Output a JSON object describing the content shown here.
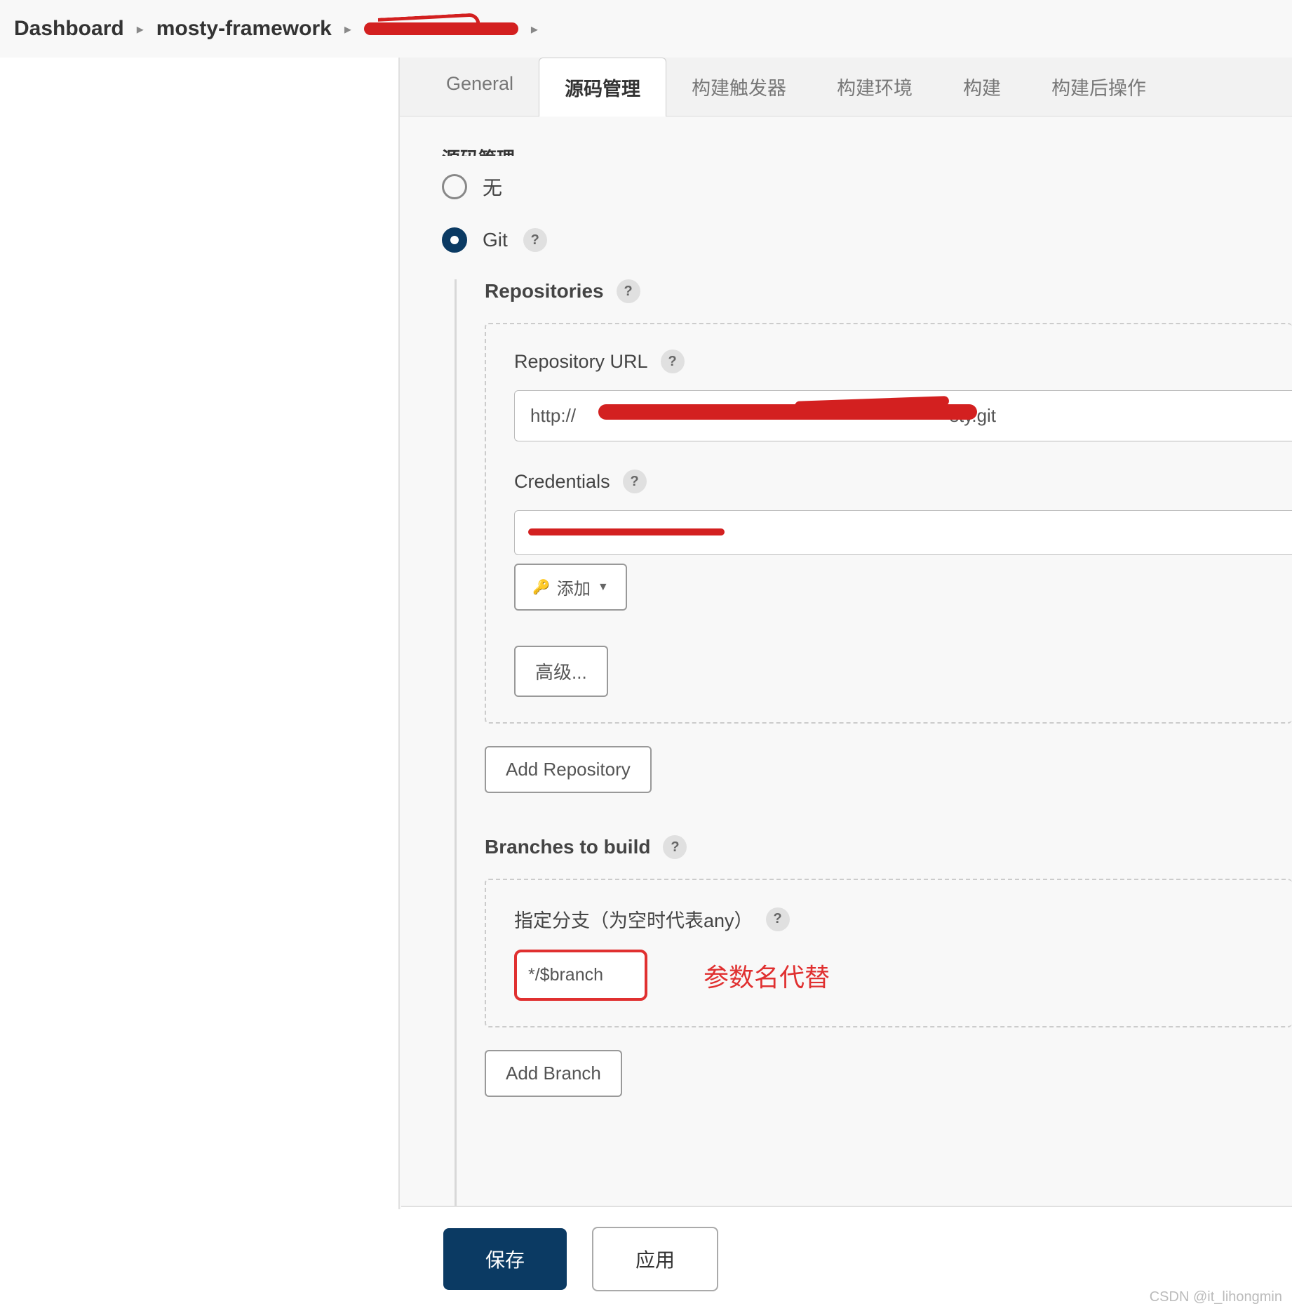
{
  "breadcrumb": {
    "items": [
      "Dashboard",
      "mosty-framework"
    ],
    "redacted_third": true
  },
  "tabs": [
    {
      "label": "General",
      "active": false
    },
    {
      "label": "源码管理",
      "active": true
    },
    {
      "label": "构建触发器",
      "active": false
    },
    {
      "label": "构建环境",
      "active": false
    },
    {
      "label": "构建",
      "active": false
    },
    {
      "label": "构建后操作",
      "active": false
    }
  ],
  "truncated_section_title": "源码管理",
  "scm_options": {
    "none_label": "无",
    "git_label": "Git"
  },
  "repositories": {
    "title": "Repositories",
    "url_label": "Repository URL",
    "url_prefix": "http://",
    "url_suffix": "sty.git",
    "credentials_label": "Credentials",
    "add_label": "添加",
    "advanced_label": "高级...",
    "add_repo_label": "Add Repository"
  },
  "branches": {
    "title": "Branches to build",
    "branch_label": "指定分支（为空时代表any）",
    "branch_value": "*/$branch",
    "annotation": "参数名代替",
    "add_branch_label": "Add Branch"
  },
  "footer": {
    "save": "保存",
    "apply": "应用"
  },
  "watermark": "CSDN @it_lihongmin"
}
